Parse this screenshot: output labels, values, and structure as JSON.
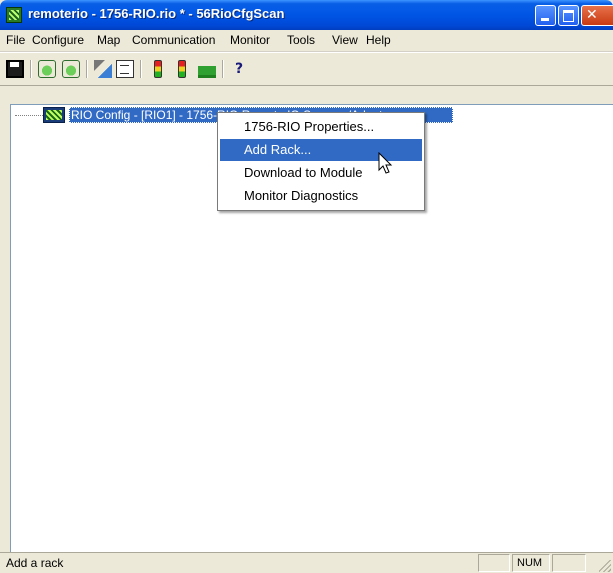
{
  "window": {
    "title": "remoterio - 1756-RIO.rio * - 56RioCfgScan"
  },
  "menubar": {
    "items": [
      "File",
      "Configure",
      "Map",
      "Communication",
      "Monitor",
      "Tools",
      "View",
      "Help"
    ]
  },
  "toolbar": {
    "icons": [
      "save-icon",
      "module-config-icon",
      "module-config-alt-icon",
      "tools-icon",
      "document-icon",
      "signal-light-icon",
      "signal-light-alt-icon",
      "plug-icon",
      "context-help-icon"
    ],
    "help_glyph": "?"
  },
  "tree": {
    "root_label": "RIO Config - [RIO1] - 1756-RIO Remote IO Scanner/Adapter"
  },
  "context_menu": {
    "items": [
      "1756-RIO Properties...",
      "Add Rack...",
      "Download to Module",
      "Monitor Diagnostics"
    ],
    "highlighted_index": 1
  },
  "statusbar": {
    "text": "Add a rack",
    "num_indicator": "NUM"
  },
  "colors": {
    "titlebar": "#0055e5",
    "selection": "#316ac5",
    "face": "#ece9d8"
  }
}
